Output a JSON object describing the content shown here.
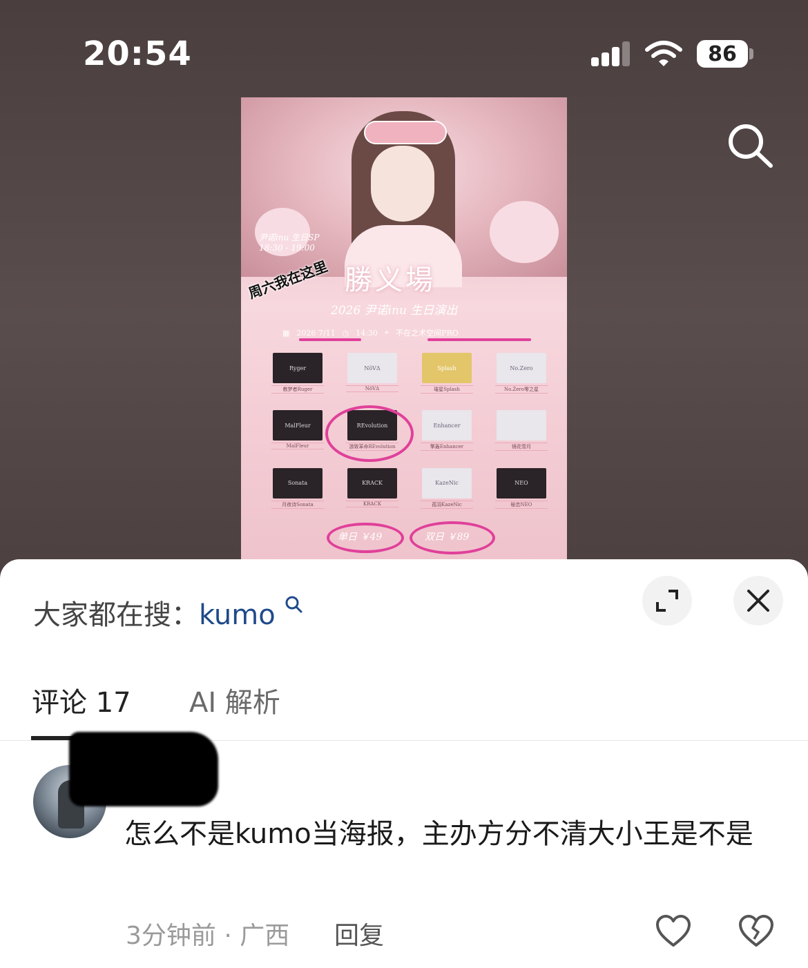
{
  "status_bar": {
    "time": "20:54",
    "battery": "86"
  },
  "poster": {
    "annotation": "周六我在这里",
    "sp_line1": "尹诺inu 生日SP",
    "sp_line2": "18:30 - 19:00",
    "title": "勝义場",
    "subtitle": "2026 尹诺inu 生日演出",
    "date": "2026 7/11",
    "time": "14:30",
    "venue": "不在之术空间PRO",
    "bands": [
      {
        "logo": "Ryger",
        "name": "教梦者Ruger",
        "style": "dark"
      },
      {
        "logo": "NöVΔ",
        "name": "NöVΔ",
        "style": "light"
      },
      {
        "logo": "Splash",
        "name": "璀星Splash",
        "style": "gold"
      },
      {
        "logo": "No.Zero",
        "name": "No.Zero零之星",
        "style": "light"
      },
      {
        "logo": "MalFleur",
        "name": "MalFleur",
        "style": "dark"
      },
      {
        "logo": "REvolution",
        "name": "游致革命REvolution",
        "style": "dark"
      },
      {
        "logo": "Enhancer",
        "name": "擎轰Enhancer",
        "style": "light"
      },
      {
        "logo": "",
        "name": "镜花雪月",
        "style": "light"
      },
      {
        "logo": "Sonata",
        "name": "月夜诗Sonata",
        "style": "dark"
      },
      {
        "logo": "KRACK",
        "name": "KRACK",
        "style": "dark"
      },
      {
        "logo": "KazeNic",
        "name": "孤羽KazeNic",
        "style": "light"
      },
      {
        "logo": "NEO",
        "name": "秘恋NEO",
        "style": "dark"
      }
    ],
    "price_single": "单日 ￥49",
    "price_double": "双日 ￥89"
  },
  "sheet": {
    "trending_label": "大家都在搜：",
    "trending_keyword": "kumo",
    "tabs": [
      {
        "label": "评论 17",
        "active": true
      },
      {
        "label": "AI 解析",
        "active": false
      }
    ]
  },
  "comment": {
    "text": "怎么不是kumo当海报，主办方分不清大小王是不是",
    "meta": "3分钟前 · 广西",
    "reply_label": "回复"
  },
  "colors": {
    "top_background": "#4b3f3f",
    "keyword": "#1f4a8a",
    "ink_mark": "#e0409a"
  }
}
